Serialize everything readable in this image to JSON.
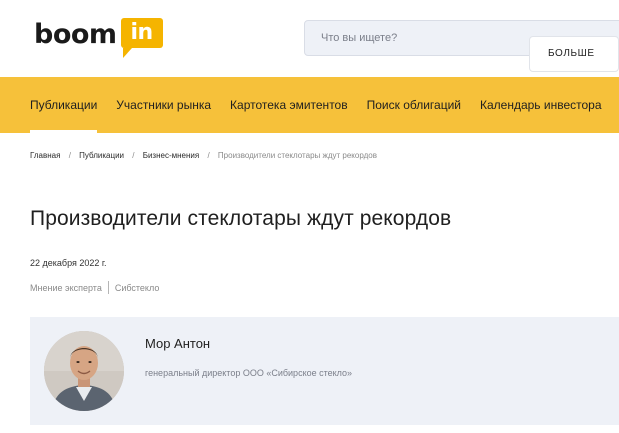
{
  "logo": {
    "word": "boom",
    "badge": "in",
    "accent": "#f5b400"
  },
  "search": {
    "placeholder": "Что вы ищете?"
  },
  "nav": {
    "background": "#f6c13a",
    "items": [
      {
        "label": "Публикации",
        "active": true
      },
      {
        "label": "Участники рынка"
      },
      {
        "label": "Картотека эмитентов"
      },
      {
        "label": "Поиск облигаций"
      },
      {
        "label": "Календарь инвестора"
      }
    ]
  },
  "breadcrumb": {
    "items": [
      "Главная",
      "Публикации",
      "Бизнес-мнения"
    ],
    "separator": "/",
    "current": "Производители стеклотары ждут рекордов"
  },
  "article": {
    "title": "Производители стеклотары ждут рекордов",
    "date": "22 декабря 2022 г.",
    "tags": [
      "Мнение эксперта",
      "Сибстекло"
    ]
  },
  "author": {
    "name": "Мор Антон",
    "role": "генеральный директор ООО «Сибирское стекло»",
    "button_label": "БОЛЬШЕ"
  }
}
